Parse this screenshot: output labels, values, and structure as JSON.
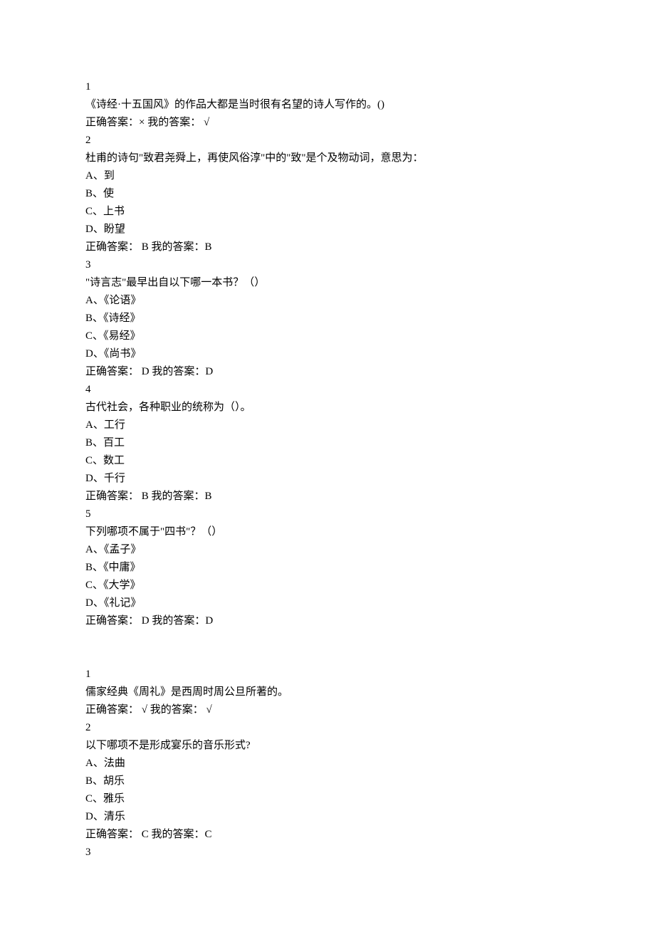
{
  "section1": {
    "q1": {
      "num": "1",
      "text": "《诗经·十五国风》的作品大都是当时很有名望的诗人写作的。()",
      "answer_line": "正确答案：× 我的答案： √"
    },
    "q2": {
      "num": "2",
      "text": "杜甫的诗句\"致君尧舜上，再使风俗淳\"中的\"致\"是个及物动词，意思为：",
      "optA": "A、到",
      "optB": "B、使",
      "optC": "C、上书",
      "optD": "D、盼望",
      "answer_line": "正确答案： B 我的答案：B"
    },
    "q3": {
      "num": "3",
      "text": "\"诗言志\"最早出自以下哪一本书？（）",
      "optA": "A、《论语》",
      "optB": "B、《诗经》",
      "optC": "C、《易经》",
      "optD": "D、《尚书》",
      "answer_line": "正确答案： D 我的答案：D"
    },
    "q4": {
      "num": "4",
      "text": "古代社会，各种职业的统称为（）。",
      "optA": "A、工行",
      "optB": "B、百工",
      "optC": "C、数工",
      "optD": "D、千行",
      "answer_line": "正确答案： B 我的答案：B"
    },
    "q5": {
      "num": "5",
      "text": "下列哪项不属于\"四书\"？（）",
      "optA": "A、《孟子》",
      "optB": "B、《中庸》",
      "optC": "C、《大学》",
      "optD": "D、《礼记》",
      "answer_line": "正确答案： D 我的答案：D"
    }
  },
  "section2": {
    "q1": {
      "num": "1",
      "text": "儒家经典《周礼》是西周时周公旦所著的。",
      "answer_line": "正确答案： √ 我的答案： √"
    },
    "q2": {
      "num": "2",
      "text": "以下哪项不是形成宴乐的音乐形式?",
      "optA": "A、法曲",
      "optB": "B、胡乐",
      "optC": "C、雅乐",
      "optD": "D、清乐",
      "answer_line": "正确答案： C 我的答案：C"
    },
    "q3": {
      "num": "3"
    }
  }
}
